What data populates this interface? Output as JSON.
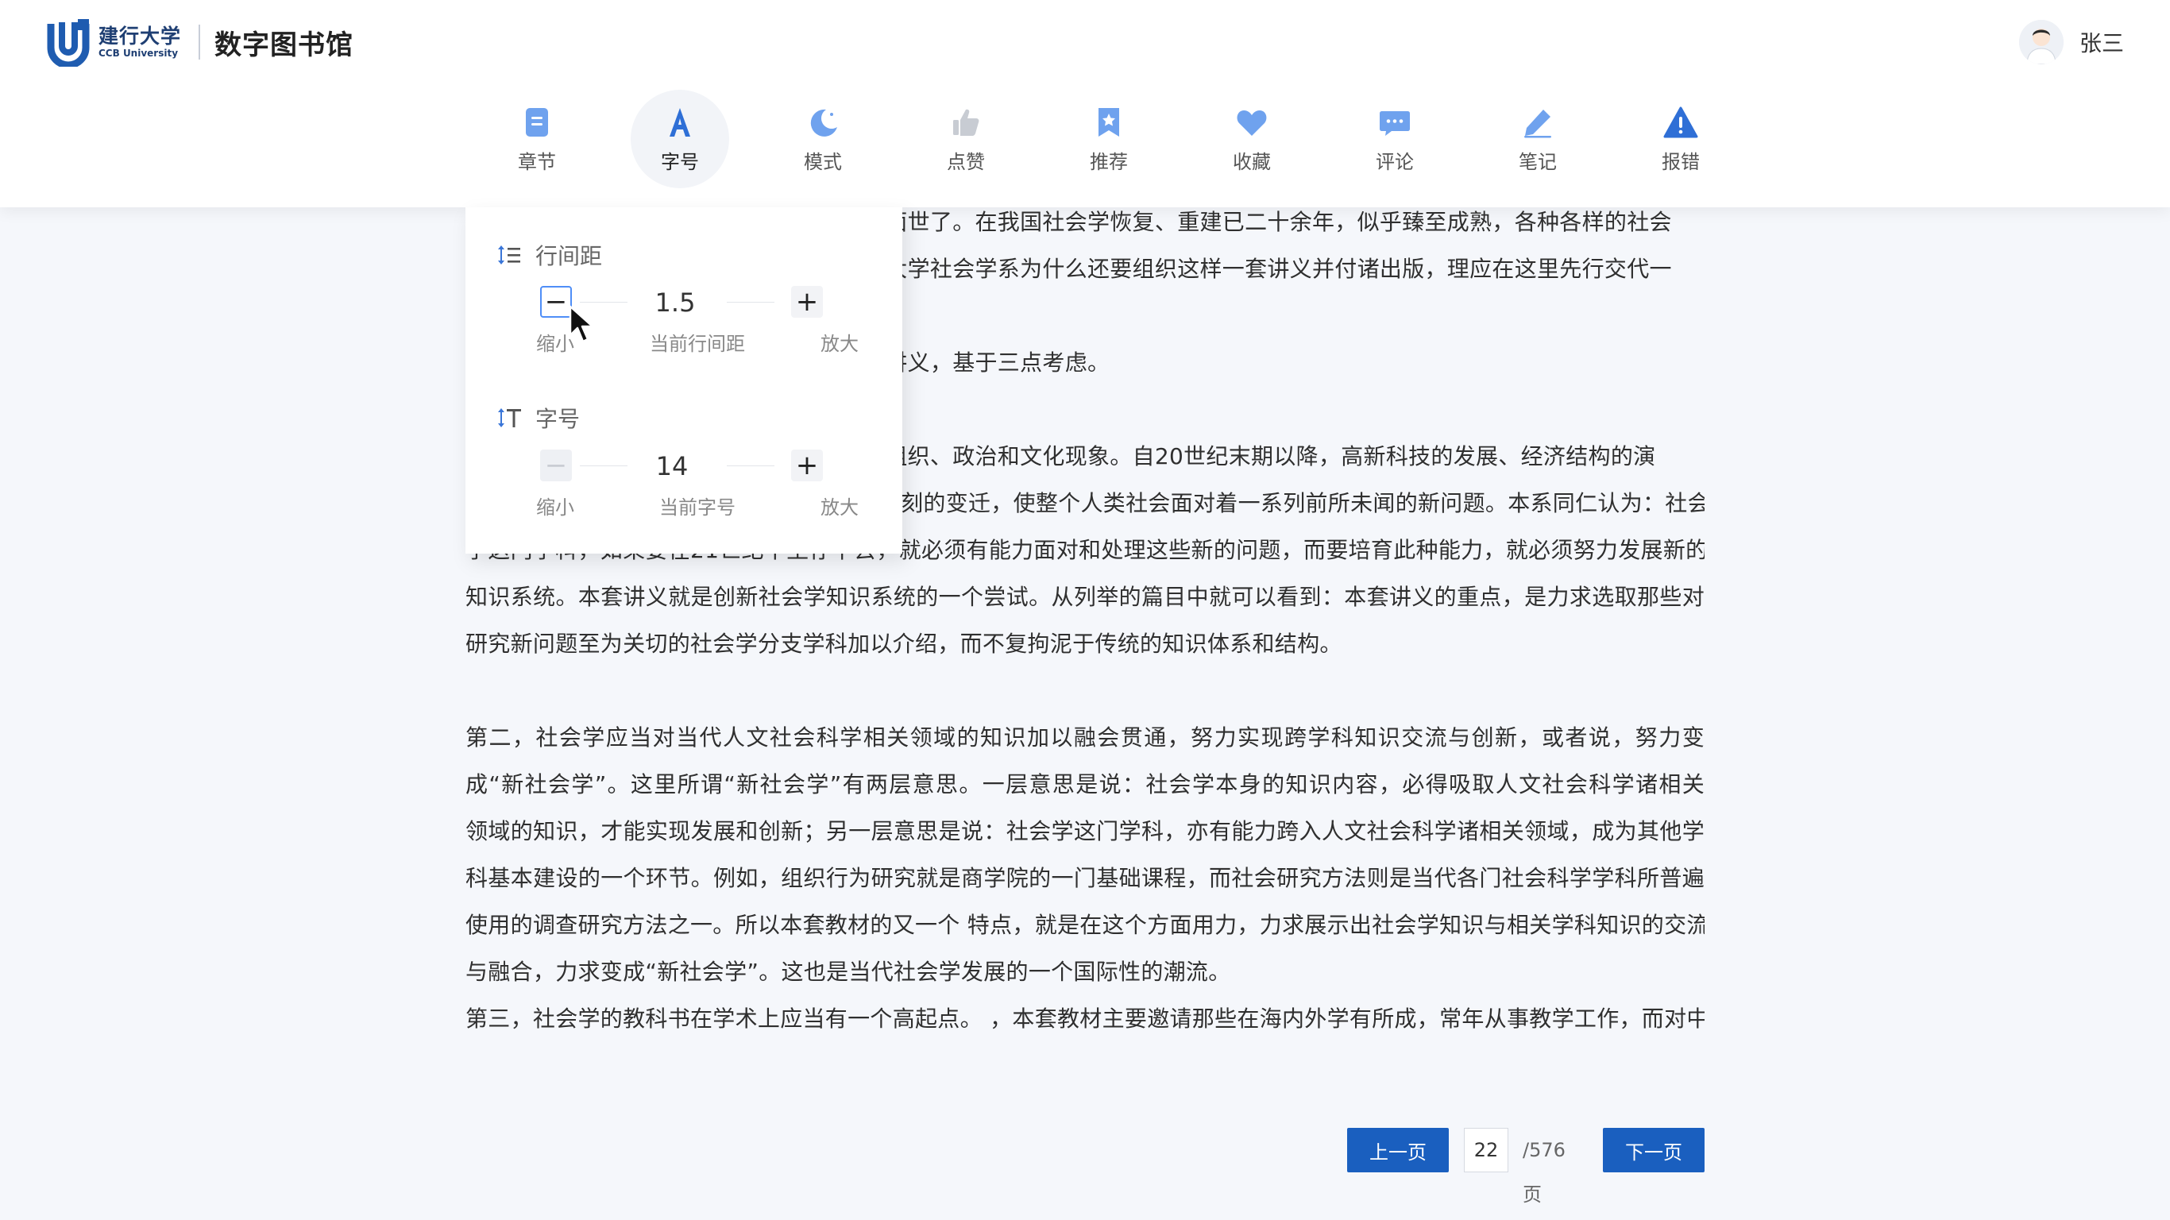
{
  "header": {
    "logo_cn": "建行大学",
    "logo_en": "CCB University",
    "site_title": "数字图书馆",
    "user_name": "张三"
  },
  "toolbar": [
    {
      "name": "chapter",
      "label": "章节",
      "icon": "chapter-icon",
      "active": false
    },
    {
      "name": "font-size",
      "label": "字号",
      "icon": "font-a-icon",
      "active": true
    },
    {
      "name": "mode",
      "label": "模式",
      "icon": "moon-icon",
      "active": false
    },
    {
      "name": "like",
      "label": "点赞",
      "icon": "thumbs-up-icon",
      "active": false
    },
    {
      "name": "recommend",
      "label": "推荐",
      "icon": "bookmark-star-icon",
      "active": false
    },
    {
      "name": "favorite",
      "label": "收藏",
      "icon": "heart-icon",
      "active": false
    },
    {
      "name": "comment",
      "label": "评论",
      "icon": "comment-icon",
      "active": false
    },
    {
      "name": "note",
      "label": "笔记",
      "icon": "pencil-icon",
      "active": false
    },
    {
      "name": "report",
      "label": "报错",
      "icon": "warning-icon",
      "active": false
    }
  ],
  "font_panel": {
    "line_spacing": {
      "title": "行间距",
      "value": "1.5",
      "decrease_label": "缩小",
      "current_label": "当前行间距",
      "increase_label": "放大"
    },
    "font_size": {
      "title": "字号",
      "value": "14",
      "decrease_label": "缩小",
      "current_label": "当前字号",
      "increase_label": "放大"
    }
  },
  "content": {
    "lines": [
      "于面世了。在我国社会学恢复、重建已二十余年，似乎臻至成熟，各种各样的社会",
      "华大学社会学系为什么还要组织这样一套讲义并付诸出版，理应在这里先行交代一",
      "",
      "套讲义，基于三点考虑。",
      "",
      "、组织、政治和文化现象。自20世纪末期以降，高新科技的发展、经济结构的演",
      "变、社会-政治体制的改革而引发的巨大、深刻的变迁，使整个人类社会面对着一系列前所未闻的新问题。本系同仁认为：社会",
      "学这门学科，如果要在21世纪中生存下去，就必须有能力面对和处理这些新的问题，而要培育此种能力，就必须努力发展新的",
      "知识系统。本套讲义就是创新社会学知识系统的一个尝试。从列举的篇目中就可以看到：本套讲义的重点，是力求选取那些对",
      "研究新问题至为关切的社会学分支学科加以介绍，而不复拘泥于传统的知识体系和结构。",
      "",
      "第二，社会学应当对当代人文社会科学相关领域的知识加以融会贯通，努力实现跨学科知识交流与创新，或者说，努力变",
      "成“新社会学”。这里所谓“新社会学”有两层意思。一层意思是说：社会学本身的知识内容，必得吸取人文社会科学诸相关",
      "领域的知识，才能实现发展和创新；另一层意思是说：社会学这门学科，亦有能力跨入人文社会科学诸相关领域，成为其他学",
      "科基本建设的一个环节。例如，组织行为研究就是商学院的一门基础课程，而社会研究方法则是当代各门社会科学学科所普遍",
      "使用的调查研究方法之一。所以本套教材的又一个  特点，就是在这个方面用力，力求展示出社会学知识与相关学科知识的交流",
      "与融合，力求变成“新社会学”。这也是当代社会学发展的一个国际性的潮流。",
      "第三，社会学的教科书在学术上应当有一个高起点。    ，本套教材主要邀请那些在海内外学有所成，常年从事教学工作，而对中"
    ]
  },
  "pager": {
    "prev_label": "上一页",
    "current_page": "22",
    "total_label": "/576页",
    "next_label": "下一页"
  },
  "colors": {
    "accent": "#1a5fbf",
    "icon_light": "#6fa2ee",
    "icon_dark": "#2f6fd6",
    "thumb_gray": "#c8ccd3"
  }
}
